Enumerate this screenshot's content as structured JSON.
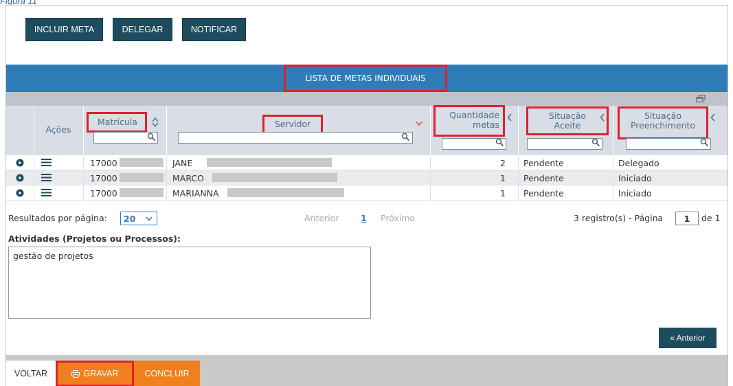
{
  "caption": "Figura 11",
  "toolbar": {
    "incluir_meta": "INCLUIR META",
    "delegar": "DELEGAR",
    "notificar": "NOTIFICAR"
  },
  "list": {
    "title": "LISTA DE METAS INDIVIDUAIS"
  },
  "columns": {
    "acoes": "Ações",
    "matricula": "Matrícula",
    "servidor": "Servidor",
    "quantidade_l1": "Quantidade",
    "quantidade_l2": "metas",
    "aceite_l1": "Situação",
    "aceite_l2": "Aceite",
    "preench_l1": "Situação",
    "preench_l2": "Preenchimento"
  },
  "rows": [
    {
      "matricula": "17000",
      "servidor": "JANE",
      "quantidade": "2",
      "situacao_aceite": "Pendente",
      "situacao_preenchimento": "Delegado"
    },
    {
      "matricula": "17000",
      "servidor": "MARCO",
      "quantidade": "1",
      "situacao_aceite": "Pendente",
      "situacao_preenchimento": "Iniciado"
    },
    {
      "matricula": "17000",
      "servidor": "MARIANNA",
      "quantidade": "1",
      "situacao_aceite": "Pendente",
      "situacao_preenchimento": "Iniciado"
    }
  ],
  "pager": {
    "results_label": "Resultados por página:",
    "page_size": "20",
    "anterior": "Anterior",
    "current_page": "1",
    "proximo": "Próximo",
    "summary_prefix": "3 registro(s) - Página",
    "page_input": "1",
    "summary_suffix": "de 1"
  },
  "atividades": {
    "label": "Atividades (Projetos ou Processos):",
    "value": "gestão de projetos"
  },
  "nav": {
    "anterior_button": "« Anterior"
  },
  "footer": {
    "voltar": "VOLTAR",
    "gravar": "GRAVAR",
    "concluir": "CONCLUIR"
  },
  "colors": {
    "header_blue": "#2e7db9",
    "dark_button": "#1e4c5e",
    "orange": "#f07f1e",
    "highlight_red": "#e0202a"
  }
}
